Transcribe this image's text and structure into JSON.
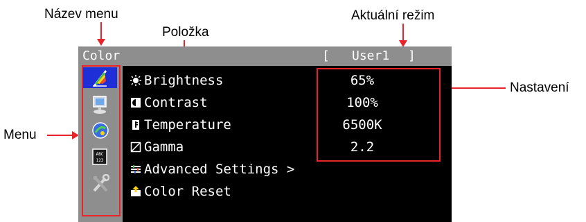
{
  "callouts": {
    "menu_name": "Název menu",
    "item": "Položka",
    "current_mode": "Aktuální režim",
    "menu": "Menu",
    "setting": "Nastavení"
  },
  "osd": {
    "title": "Color",
    "mode_open": "[",
    "mode": "User1",
    "mode_close": "]",
    "sidebar_icons": [
      {
        "name": "color-icon",
        "selected": true
      },
      {
        "name": "screen-icon",
        "selected": false
      },
      {
        "name": "power-save-icon",
        "selected": false
      },
      {
        "name": "language-icon",
        "selected": false
      },
      {
        "name": "tools-icon",
        "selected": false
      }
    ],
    "items": [
      {
        "label": "Brightness",
        "value": "65%",
        "icon": "brightness-icon"
      },
      {
        "label": "Contrast",
        "value": "100%",
        "icon": "contrast-icon"
      },
      {
        "label": "Temperature",
        "value": "6500K",
        "icon": "temperature-icon"
      },
      {
        "label": "Gamma",
        "value": "2.2",
        "icon": "gamma-icon"
      },
      {
        "label": "Advanced Settings >",
        "value": "",
        "icon": "advanced-settings-icon"
      },
      {
        "label": "Color Reset",
        "value": "",
        "icon": "color-reset-icon"
      }
    ]
  },
  "colors": {
    "osd_background": "#000000",
    "osd_bar": "#8e8e8e",
    "selection": "#1e2fd8",
    "callout_red": "#e8232a"
  }
}
